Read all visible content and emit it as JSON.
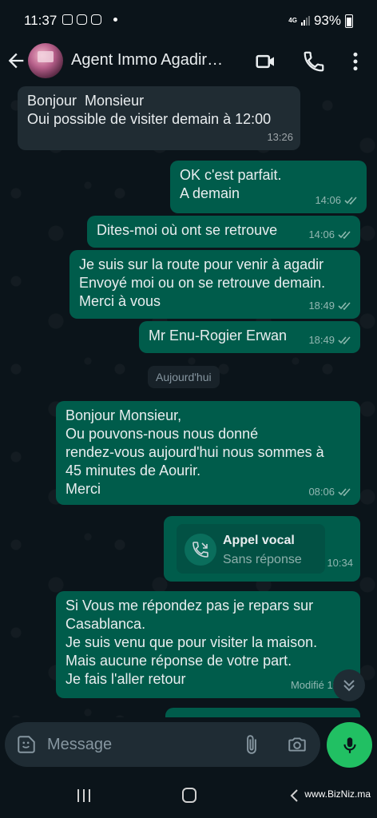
{
  "status_bar": {
    "time": "11:37",
    "network": "4G",
    "battery": "93%"
  },
  "header": {
    "contact_name": "Agent Immo Agadir…",
    "icons": [
      "back-arrow-icon",
      "video-call-icon",
      "phone-icon",
      "more-vert-icon"
    ]
  },
  "messages": [
    {
      "dir": "in",
      "text": "Bonjour  Monsieur\nOui possible de visiter demain à 12:00",
      "time": "13:26"
    },
    {
      "dir": "out",
      "text": "OK c'est parfait.\nA demain",
      "time": "14:06",
      "status": "read"
    },
    {
      "dir": "out",
      "text": "Dites-moi où ont se retrouve",
      "time": "14:06",
      "status": "read"
    },
    {
      "dir": "out",
      "text": "Je suis sur la route pour venir à agadir\nEnvoyé moi ou on se retrouve demain.\nMerci à vous",
      "time": "18:49",
      "status": "read"
    },
    {
      "dir": "out",
      "text": "Mr Enu-Rogier Erwan",
      "time": "18:49",
      "status": "read"
    },
    {
      "dir": "out",
      "text": "Bonjour Monsieur,\nOu pouvons-nous nous donné\nrendez-vous aujourd'hui nous sommes à\n45 minutes de Aourir.\nMerci",
      "time": "08:06",
      "status": "read"
    },
    {
      "dir": "out",
      "text": "Si Vous me répondez pas je repars sur\nCasablanca.\nJe suis venu que pour visiter la maison.\nMais aucune réponse de votre part.\nJe fais l'aller retour",
      "time": "Modifié 10:38"
    }
  ],
  "date_separator": "Aujourd'hui",
  "voice_call": {
    "title": "Appel vocal",
    "subtitle": "Sans réponse",
    "time": "10:34"
  },
  "composer": {
    "placeholder": "Message"
  },
  "watermark": "www.BizNiz.ma",
  "colors": {
    "incoming_bubble": "#202c33",
    "outgoing_bubble": "#005c4b",
    "background": "#0b141a",
    "accent": "#21c063",
    "read_checks": "#8bb8ad"
  }
}
